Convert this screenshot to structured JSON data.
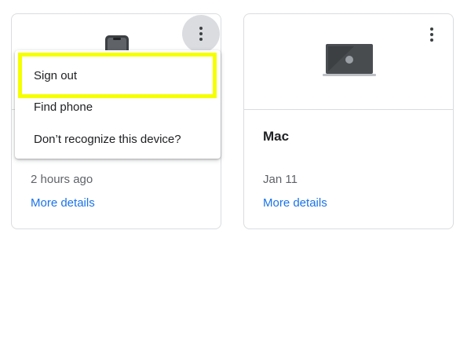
{
  "colors": {
    "link": "#1a73e8",
    "highlight": "#f5ff00",
    "border": "#dadce0",
    "text_secondary": "#5f6368"
  },
  "menu": {
    "items": [
      {
        "label": "Sign out",
        "highlighted": true
      },
      {
        "label": "Find phone"
      },
      {
        "label": "Don’t recognize this device?"
      }
    ]
  },
  "devices": [
    {
      "icon": "phone-icon",
      "name": "",
      "last_active": "2 hours ago",
      "link": "More details",
      "menu_open": true
    },
    {
      "icon": "laptop-icon",
      "name": "Mac",
      "last_active": "Jan 11",
      "link": "More details",
      "menu_open": false
    }
  ]
}
